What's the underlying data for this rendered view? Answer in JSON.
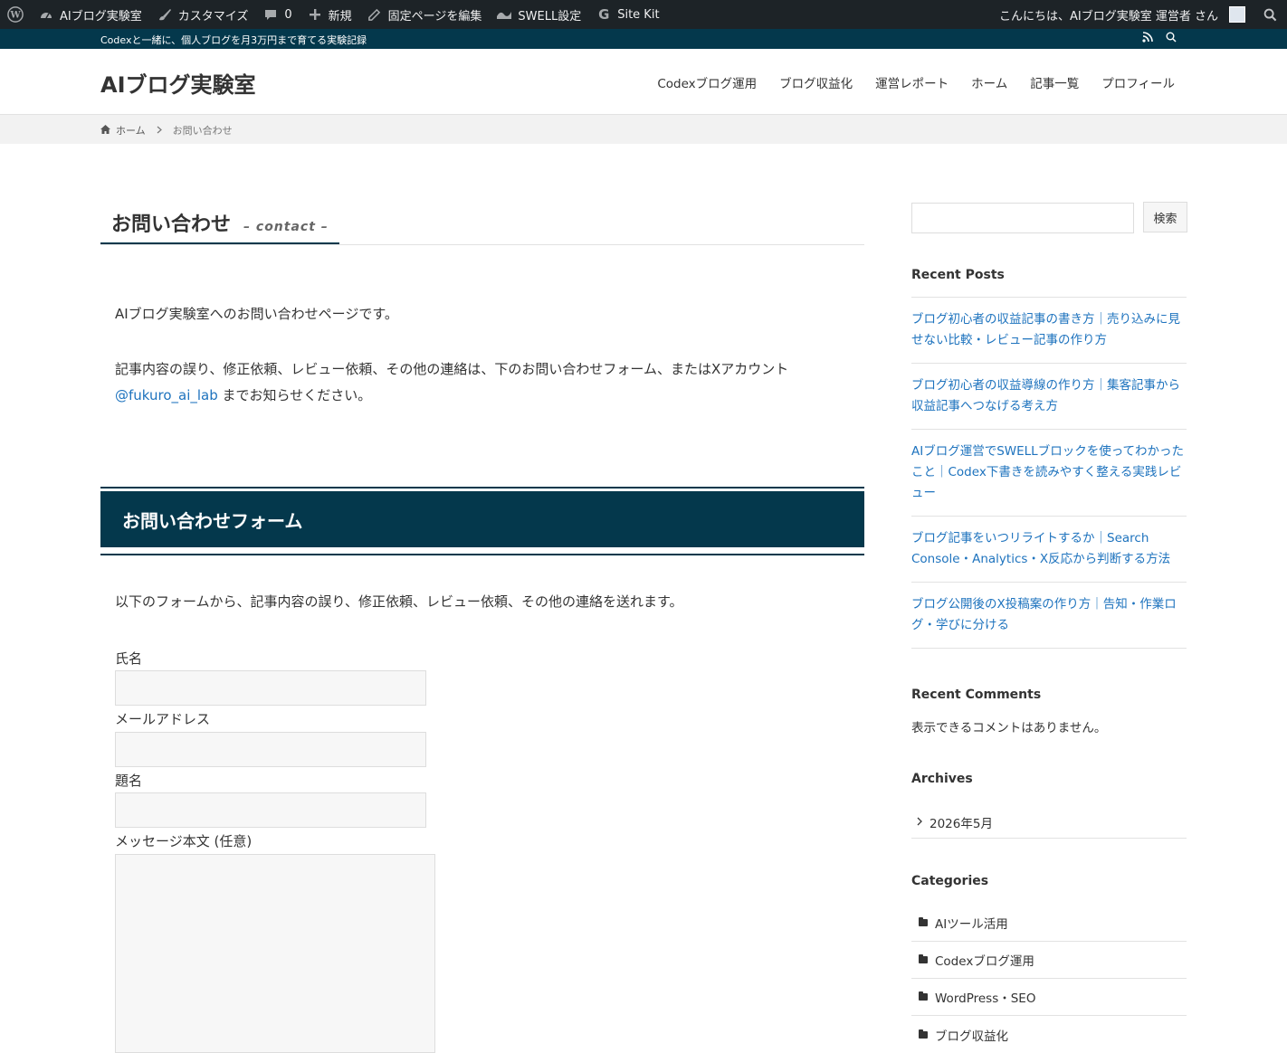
{
  "adminbar": {
    "site_name": "AIブログ実験室",
    "customize": "カスタマイズ",
    "comments_count": "0",
    "new": "新規",
    "edit_page": "固定ページを編集",
    "swell_settings": "SWELL設定",
    "site_kit": "Site Kit",
    "greeting": "こんにちは、AIブログ実験室 運営者 さん"
  },
  "infobar": {
    "tagline": "Codexと一緒に、個人ブログを月3万円まで育てる実験記録"
  },
  "header": {
    "site_title": "AIブログ実験室",
    "nav": [
      "Codexブログ運用",
      "ブログ収益化",
      "運営レポート",
      "ホーム",
      "記事一覧",
      "プロフィール"
    ]
  },
  "breadcrumb": {
    "home": "ホーム",
    "current": "お問い合わせ"
  },
  "page": {
    "title": "お問い合わせ",
    "subtitle": "– contact –",
    "intro": "AIブログ実験室へのお問い合わせページです。",
    "desc_line1": "記事内容の誤り、修正依頼、レビュー依頼、その他の連絡は、下のお問い合わせフォーム、またはXアカウント",
    "x_link": "@fukuro_ai_lab",
    "desc_line2_rest": " までお知らせください。",
    "form_heading": "お問い合わせフォーム",
    "form_intro": "以下のフォームから、記事内容の誤り、修正依頼、レビュー依頼、その他の連絡を送れます。",
    "fields": {
      "name": "氏名",
      "email": "メールアドレス",
      "subject": "題名",
      "message": "メッセージ本文 (任意)"
    }
  },
  "sidebar": {
    "search_button": "検索",
    "recent_posts_title": "Recent Posts",
    "recent_posts": [
      "ブログ初心者の収益記事の書き方｜売り込みに見せない比較・レビュー記事の作り方",
      "ブログ初心者の収益導線の作り方｜集客記事から収益記事へつなげる考え方",
      "AIブログ運営でSWELLブロックを使ってわかったこと｜Codex下書きを読みやすく整える実践レビュー",
      "ブログ記事をいつリライトするか｜Search Console・Analytics・X反応から判断する方法",
      "ブログ公開後のX投稿案の作り方｜告知・作業ログ・学びに分ける"
    ],
    "recent_comments_title": "Recent Comments",
    "no_comments": "表示できるコメントはありません。",
    "archives_title": "Archives",
    "archives": [
      "2026年5月"
    ],
    "categories_title": "Categories",
    "categories": [
      "AIツール活用",
      "Codexブログ運用",
      "WordPress・SEO",
      "ブログ収益化"
    ]
  }
}
